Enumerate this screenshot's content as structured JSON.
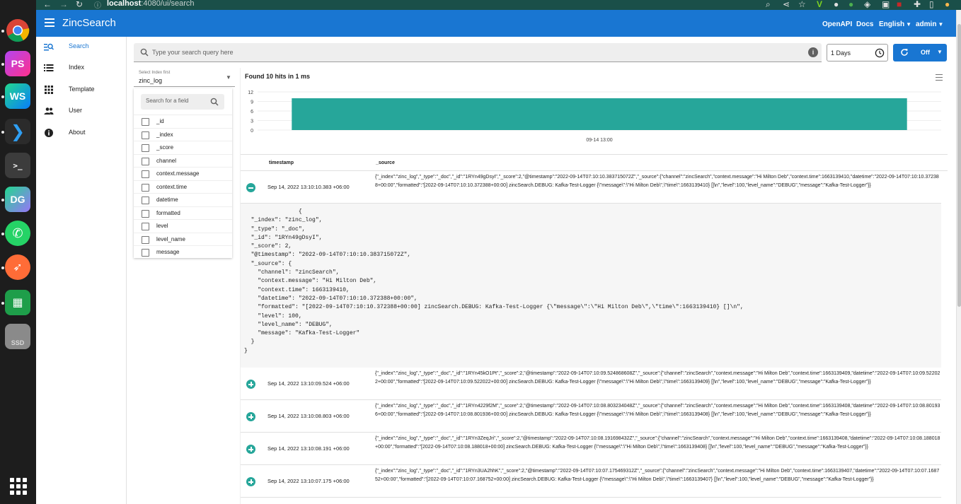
{
  "browser": {
    "url_host": "localhost",
    "url_path": ":4080/ui/search"
  },
  "header": {
    "title": "ZincSearch",
    "links": [
      "OpenAPI",
      "Docs",
      "English",
      "admin"
    ]
  },
  "sidebar": {
    "items": [
      {
        "label": "Search",
        "icon": "search-list-icon",
        "active": true
      },
      {
        "label": "Index",
        "icon": "list-icon",
        "active": false
      },
      {
        "label": "Template",
        "icon": "grid-icon",
        "active": false
      },
      {
        "label": "User",
        "icon": "people-icon",
        "active": false
      },
      {
        "label": "About",
        "icon": "info-icon",
        "active": false
      }
    ]
  },
  "search": {
    "placeholder": "Type your search query here",
    "date_range": "1 Days",
    "refresh_label": "Off"
  },
  "index_selector": {
    "caption": "Select Index first",
    "value": "zinc_log"
  },
  "fields": {
    "search_placeholder": "Search for a field",
    "items": [
      "_id",
      "_index",
      "_score",
      "channel",
      "context.message",
      "context.time",
      "datetime",
      "formatted",
      "level",
      "level_name",
      "message"
    ]
  },
  "results": {
    "hits_text": "Found 10 hits in 1 ms",
    "columns": [
      "timestamp",
      "_source"
    ],
    "rows": [
      {
        "timestamp": "Sep 14, 2022 13:10:10.383 +06:00",
        "expanded": true,
        "source": "{\"_index\":\"zinc_log\",\"_type\":\"_doc\",\"_id\":\"1RYn49gDsyI\",\"_score\":2,\"@timestamp\":\"2022-09-14T07:10:10.383715072Z\",\"_source\":{\"channel\":\"zincSearch\",\"context.message\":\"Hi Milton Deb\",\"context.time\":1663139410,\"datetime\":\"2022-09-14T07:10:10.372388+00:00\",\"formatted\":\"[2022-09-14T07:10:10.372388+00:00] zincSearch.DEBUG: Kafka-Test-Logger {\\\"message\\\":\\\"Hi Milton Deb\\\",\\\"time\\\":1663139410} []\\n\",\"level\":100,\"level_name\":\"DEBUG\",\"message\":\"Kafka-Test-Logger\"}}"
      },
      {
        "timestamp": "Sep 14, 2022 13:10:09.524 +06:00",
        "expanded": false,
        "source": "{\"_index\":\"zinc_log\",\"_type\":\"_doc\",\"_id\":\"1RYn45kO1Pt\",\"_score\":2,\"@timestamp\":\"2022-09-14T07:10:09.524868608Z\",\"_source\":{\"channel\":\"zincSearch\",\"context.message\":\"Hi Milton Deb\",\"context.time\":1663139409,\"datetime\":\"2022-09-14T07:10:09.522022+00:00\",\"formatted\":\"[2022-09-14T07:10:09.522022+00:00] zincSearch.DEBUG: Kafka-Test-Logger {\\\"message\\\":\\\"Hi Milton Deb\\\",\\\"time\\\":1663139409} []\\n\",\"level\":100,\"level_name\":\"DEBUG\",\"message\":\"Kafka-Test-Logger\"}}"
      },
      {
        "timestamp": "Sep 14, 2022 13:10:08.803 +06:00",
        "expanded": false,
        "source": "{\"_index\":\"zinc_log\",\"_type\":\"_doc\",\"_id\":\"1RYn4229f2M\",\"_score\":2,\"@timestamp\":\"2022-09-14T07:10:08.803234048Z\",\"_source\":{\"channel\":\"zincSearch\",\"context.message\":\"Hi Milton Deb\",\"context.time\":1663139408,\"datetime\":\"2022-09-14T07:10:08.801936+00:00\",\"formatted\":\"[2022-09-14T07:10:08.801936+00:00] zincSearch.DEBUG: Kafka-Test-Logger {\\\"message\\\":\\\"Hi Milton Deb\\\",\\\"time\\\":1663139408} []\\n\",\"level\":100,\"level_name\":\"DEBUG\",\"message\":\"Kafka-Test-Logger\"}}"
      },
      {
        "timestamp": "Sep 14, 2022 13:10:08.191 +06:00",
        "expanded": false,
        "source": "{\"_index\":\"zinc_log\",\"_type\":\"_doc\",\"_id\":\"1RYn3ZeqJri\",\"_score\":2,\"@timestamp\":\"2022-09-14T07:10:08.191698432Z\",\"_source\":{\"channel\":\"zincSearch\",\"context.message\":\"Hi Milton Deb\",\"context.time\":1663139408,\"datetime\":\"2022-09-14T07:10:08.188018+00:00\",\"formatted\":\"[2022-09-14T07:10:08.188018+00:00] zincSearch.DEBUG: Kafka-Test-Logger {\\\"message\\\":\\\"Hi Milton Deb\\\",\\\"time\\\":1663139408} []\\n\",\"level\":100,\"level_name\":\"DEBUG\",\"message\":\"Kafka-Test-Logger\"}}"
      },
      {
        "timestamp": "Sep 14, 2022 13:10:07.175 +06:00",
        "expanded": false,
        "source": "{\"_index\":\"zinc_log\",\"_type\":\"_doc\",\"_id\":\"1RYn3UA2hhK\",\"_score\":2,\"@timestamp\":\"2022-09-14T07:10:07.175469312Z\",\"_source\":{\"channel\":\"zincSearch\",\"context.message\":\"Hi Milton Deb\",\"context.time\":1663139407,\"datetime\":\"2022-09-14T07:10:07.168752+00:00\",\"formatted\":\"[2022-09-14T07:10:07.168752+00:00] zincSearch.DEBUG: Kafka-Test-Logger {\\\"message\\\":\\\"Hi Milton Deb\\\",\\\"time\\\":1663139407} []\\n\",\"level\":100,\"level_name\":\"DEBUG\",\"message\":\"Kafka-Test-Logger\"}}"
      }
    ],
    "expanded_json": "                {\n  \"_index\": \"zinc_log\",\n  \"_type\": \"_doc\",\n  \"_id\": \"1RYn49gDsyI\",\n  \"_score\": 2,\n  \"@timestamp\": \"2022-09-14T07:10:10.383715072Z\",\n  \"_source\": {\n    \"channel\": \"zincSearch\",\n    \"context.message\": \"Hi Milton Deb\",\n    \"context.time\": 1663139410,\n    \"datetime\": \"2022-09-14T07:10:10.372388+00:00\",\n    \"formatted\": \"[2022-09-14T07:10:10.372388+00:00] zincSearch.DEBUG: Kafka-Test-Logger {\\\"message\\\":\\\"Hi Milton Deb\\\",\\\"time\\\":1663139410} []\\n\",\n    \"level\": 100,\n    \"level_name\": \"DEBUG\",\n    \"message\": \"Kafka-Test-Logger\"\n  }\n}"
  },
  "chart_data": {
    "type": "bar",
    "categories": [
      "09-14 13:00"
    ],
    "values": [
      10
    ],
    "ylim": [
      0,
      12
    ],
    "yticks": [
      0,
      3,
      6,
      9,
      12
    ],
    "bar_color": "#26a69a",
    "grid": true
  },
  "colors": {
    "primary": "#1976d2",
    "accent": "#26a69a"
  }
}
